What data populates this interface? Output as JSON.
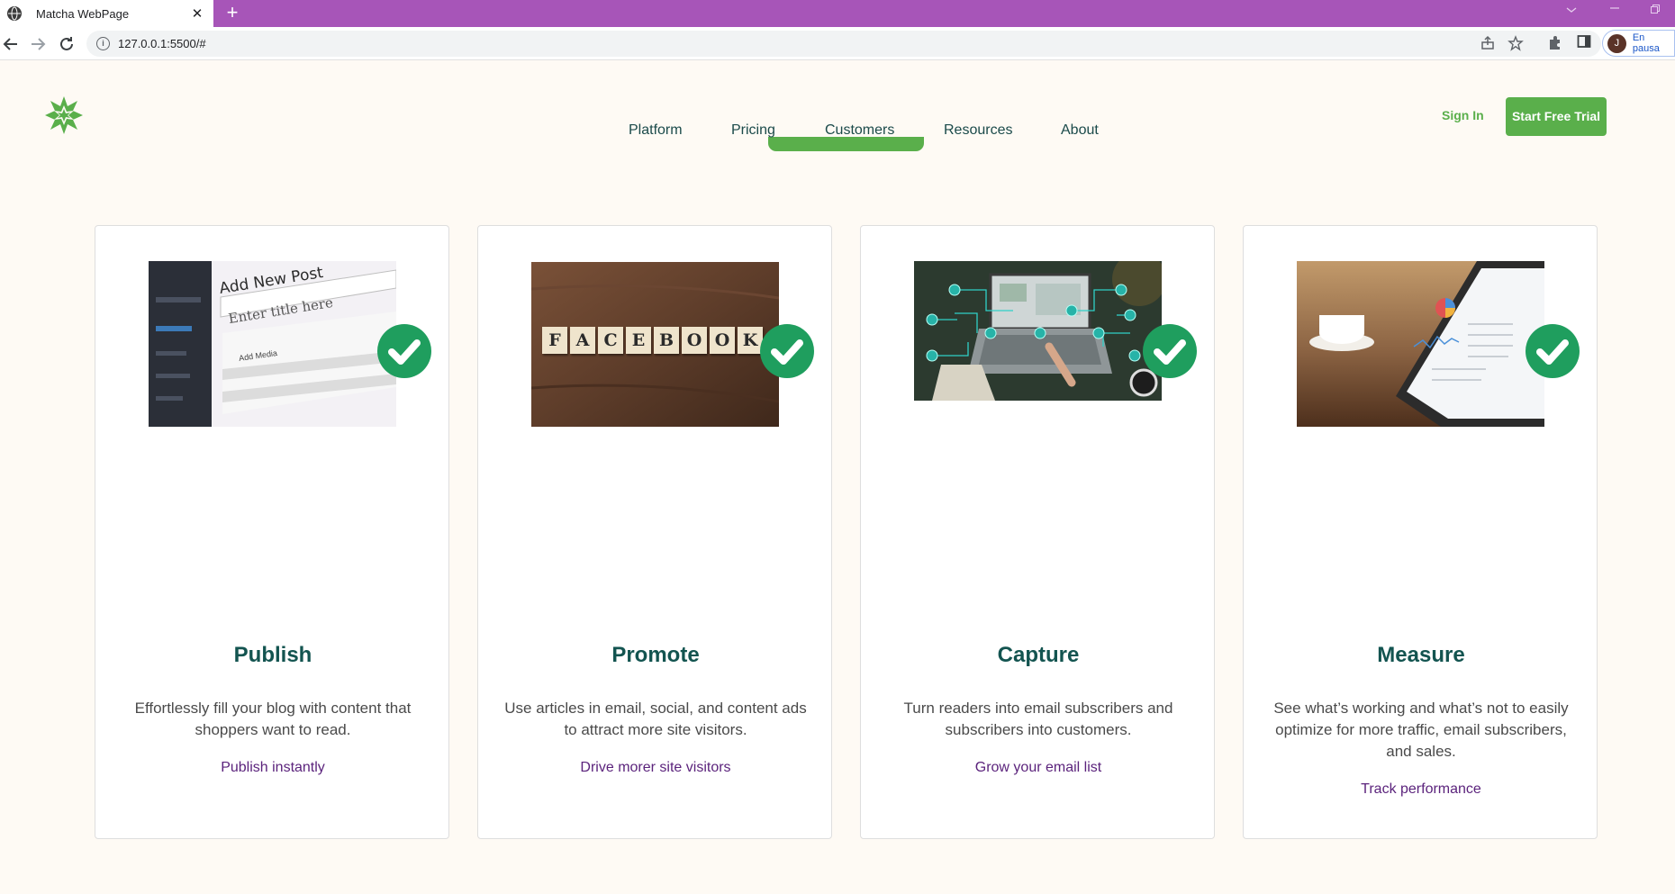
{
  "browser": {
    "tab_title": "Matcha WebPage",
    "tab_close": "✕",
    "new_tab": "+",
    "url": "127.0.0.1:5500/#",
    "profile_initial": "J",
    "profile_label": "En pausa"
  },
  "header": {
    "nav": [
      "Platform",
      "Pricing",
      "Customers",
      "Resources",
      "About"
    ],
    "sign_in": "Sign In",
    "cta": "Start Free Trial"
  },
  "cards": [
    {
      "title": "Publish",
      "description": "Effortlessly fill your blog with content that shoppers want to read.",
      "link": "Publish instantly",
      "image": "wordpress-add-new-post-screen",
      "image_text": {
        "heading": "Add New Post",
        "placeholder": "Enter title here",
        "button": "Add Media"
      }
    },
    {
      "title": "Promote",
      "description": "Use articles in email, social, and content ads to attract more site visitors.",
      "link": "Drive morer site visitors",
      "image": "scrabble-tiles-facebook",
      "image_text": {
        "tiles": [
          "F",
          "A",
          "C",
          "E",
          "B",
          "O",
          "O",
          "K"
        ]
      }
    },
    {
      "title": "Capture",
      "description": "Turn readers into email subscribers and subscribers into customers.",
      "link": "Grow your email list",
      "image": "laptop-network-people"
    },
    {
      "title": "Measure",
      "description": "See what’s working and what’s not to easily optimize for more traffic, email subscribers, and sales.",
      "link": "Track performance",
      "image": "tablet-analytics-dashboard"
    }
  ],
  "colors": {
    "tab_strip": "#a755b8",
    "page_bg": "#fefaf4",
    "brand_green": "#5aaf4b",
    "check_green": "#1f9e5e",
    "title_teal": "#135450",
    "link_purple": "#5b237c"
  },
  "icons": [
    "globe-icon",
    "back-arrow-icon",
    "forward-arrow-icon",
    "reload-icon",
    "info-icon",
    "share-icon",
    "star-icon",
    "puzzle-icon",
    "sidepanel-icon",
    "checkmark-icon",
    "logo-star-icon"
  ]
}
